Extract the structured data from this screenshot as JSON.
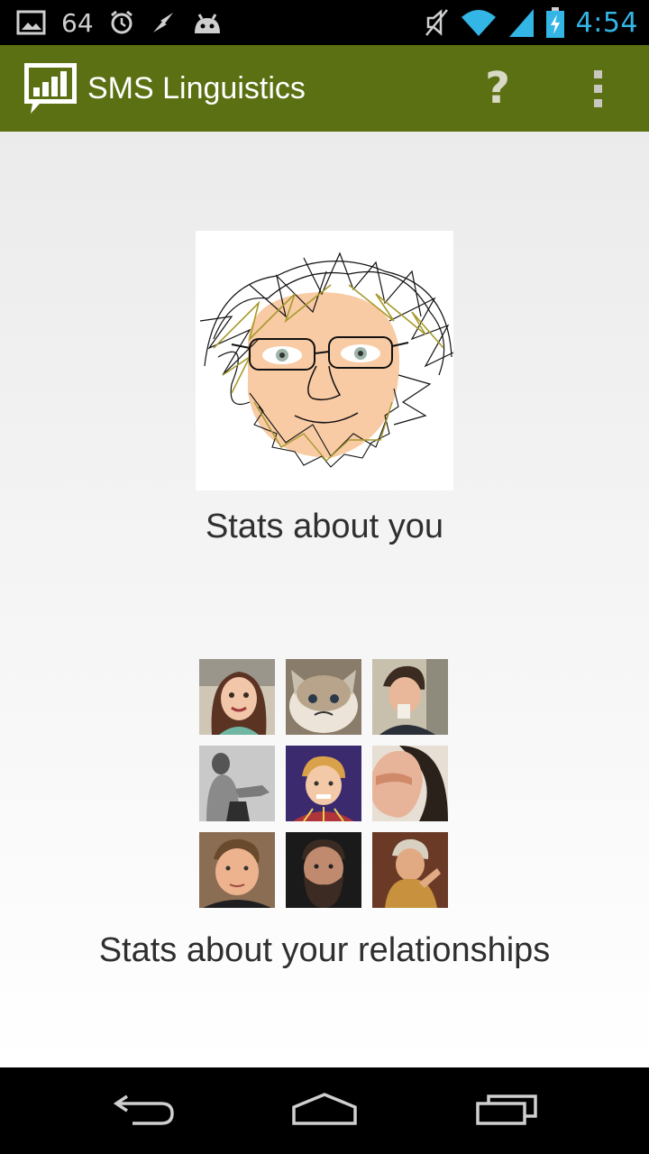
{
  "status_bar": {
    "notification_count": "64",
    "clock": "4:54",
    "accent": "#33b5e5"
  },
  "action_bar": {
    "title": "SMS Linguistics",
    "help_label": "?",
    "background": "#5b7012"
  },
  "main": {
    "you_caption": "Stats about you",
    "relationships_caption": "Stats about your relationships"
  },
  "nav_bar": {
    "icons": [
      "back-icon",
      "home-icon",
      "recent-apps-icon"
    ]
  }
}
